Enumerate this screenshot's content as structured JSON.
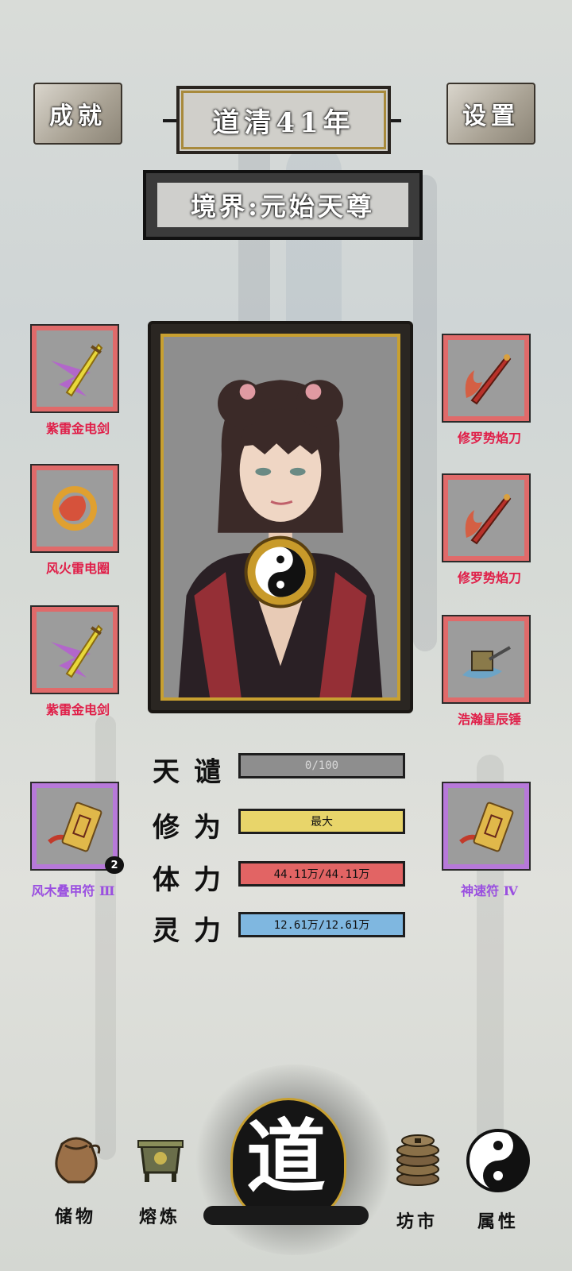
{
  "header": {
    "achievements_label": "成就",
    "year_title": "道清41年",
    "settings_label": "设置",
    "realm_label": "境界:元始天尊"
  },
  "left_slots": [
    {
      "name": "紫雷金电剑",
      "icon": "purple-lightning-sword-icon",
      "quality": "red"
    },
    {
      "name": "风火雷电圈",
      "icon": "fire-ring-icon",
      "quality": "red"
    },
    {
      "name": "紫雷金电剑",
      "icon": "purple-lightning-sword-icon",
      "quality": "red"
    },
    {
      "name": "风木叠甲符 Ⅲ",
      "icon": "talisman-scroll-icon",
      "quality": "purple",
      "count": "2"
    }
  ],
  "right_slots": [
    {
      "name": "修罗势焰刀",
      "icon": "flame-blade-icon",
      "quality": "red"
    },
    {
      "name": "修罗势焰刀",
      "icon": "flame-blade-icon",
      "quality": "red"
    },
    {
      "name": "浩瀚星辰锤",
      "icon": "star-hammer-icon",
      "quality": "red"
    },
    {
      "name": "神速符 Ⅳ",
      "icon": "talisman-scroll-icon",
      "quality": "purple"
    }
  ],
  "stats": [
    {
      "label": "天谴",
      "value": "0/100",
      "color": "#8e8e8e",
      "fill": 0.0
    },
    {
      "label": "修为",
      "value": "最大",
      "color": "#e8d56a",
      "fill": 1.0
    },
    {
      "label": "体力",
      "value": "44.11万/44.11万",
      "color": "#e26464",
      "fill": 1.0
    },
    {
      "label": "灵力",
      "value": "12.61万/12.61万",
      "color": "#7fb7e0",
      "fill": 1.0
    }
  ],
  "nav": {
    "storage": "储物",
    "smelting": "熔炼",
    "dao": "道",
    "market": "坊市",
    "attributes": "属性"
  },
  "colors": {
    "red_quality": "#e06a6a",
    "purple_quality": "#b779d9",
    "red_text": "#e01e48",
    "purple_text": "#9a4fe0"
  }
}
